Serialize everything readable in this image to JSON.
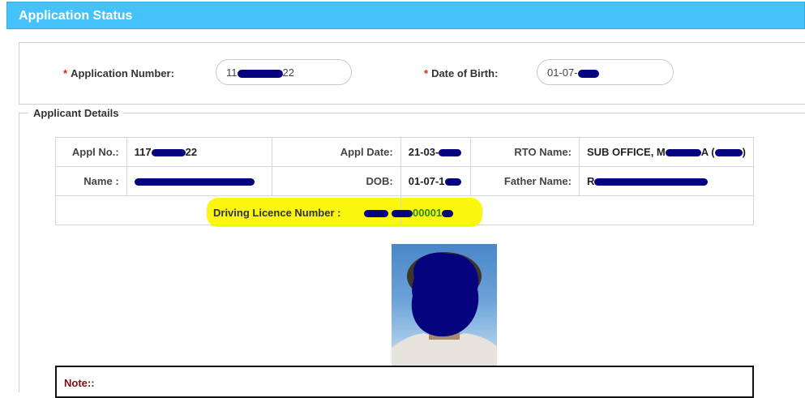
{
  "header": {
    "title": "Application Status"
  },
  "search": {
    "application_number_label": "Application Number:",
    "application_number_value_prefix": "11",
    "application_number_value_suffix": "22",
    "dob_label": "Date of Birth:",
    "dob_value_prefix": "01-07-"
  },
  "details": {
    "legend": "Applicant Details",
    "appl_no_label": "Appl No.:",
    "appl_no_prefix": "117",
    "appl_no_suffix": "22",
    "appl_date_label": "Appl Date:",
    "appl_date_prefix": "21-03-",
    "rto_name_label": "RTO Name:",
    "rto_name_prefix": "SUB OFFICE, M",
    "rto_name_mid": "A (",
    "rto_name_suffix": ")",
    "name_label": "Name :",
    "dob_label": "DOB:",
    "dob_prefix": "01-07-1",
    "father_name_label": "Father  Name:",
    "father_name_prefix": "R",
    "driving_licence_label": "Driving Licence Number :",
    "driving_licence_mid": "00001"
  },
  "note": {
    "label": "Note::"
  },
  "colors": {
    "header_bg": "#45c2f9",
    "redaction": "#06037f",
    "highlight": "#faf700",
    "licence_text": "#2a8a12",
    "required": "#d9261c"
  }
}
